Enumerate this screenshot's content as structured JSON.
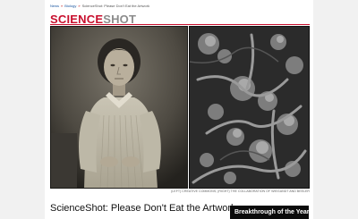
{
  "breadcrumb": {
    "items": [
      "News",
      "Biology",
      "ScienceShot: Please Don't Eat the Artwork"
    ],
    "separator": "»"
  },
  "section": {
    "title_bold": "SCIENCE",
    "title_light": "SHOT"
  },
  "images": {
    "portrait_alt": "Daguerreotype portrait",
    "micrograph_alt": "Electron micrograph"
  },
  "caption": "(LEFT) CREATIVE COMMONS; (RIGHT) THE COLLABORATION OF WIEGANDT AND BEELER",
  "headline": "ScienceShot: Please Don't Eat the Artwork",
  "promo": {
    "label": "Breakthrough of the Year"
  },
  "colors": {
    "brand_red": "#c8102e",
    "link_blue": "#1a56a0",
    "promo_bg": "#0b0b0b"
  }
}
